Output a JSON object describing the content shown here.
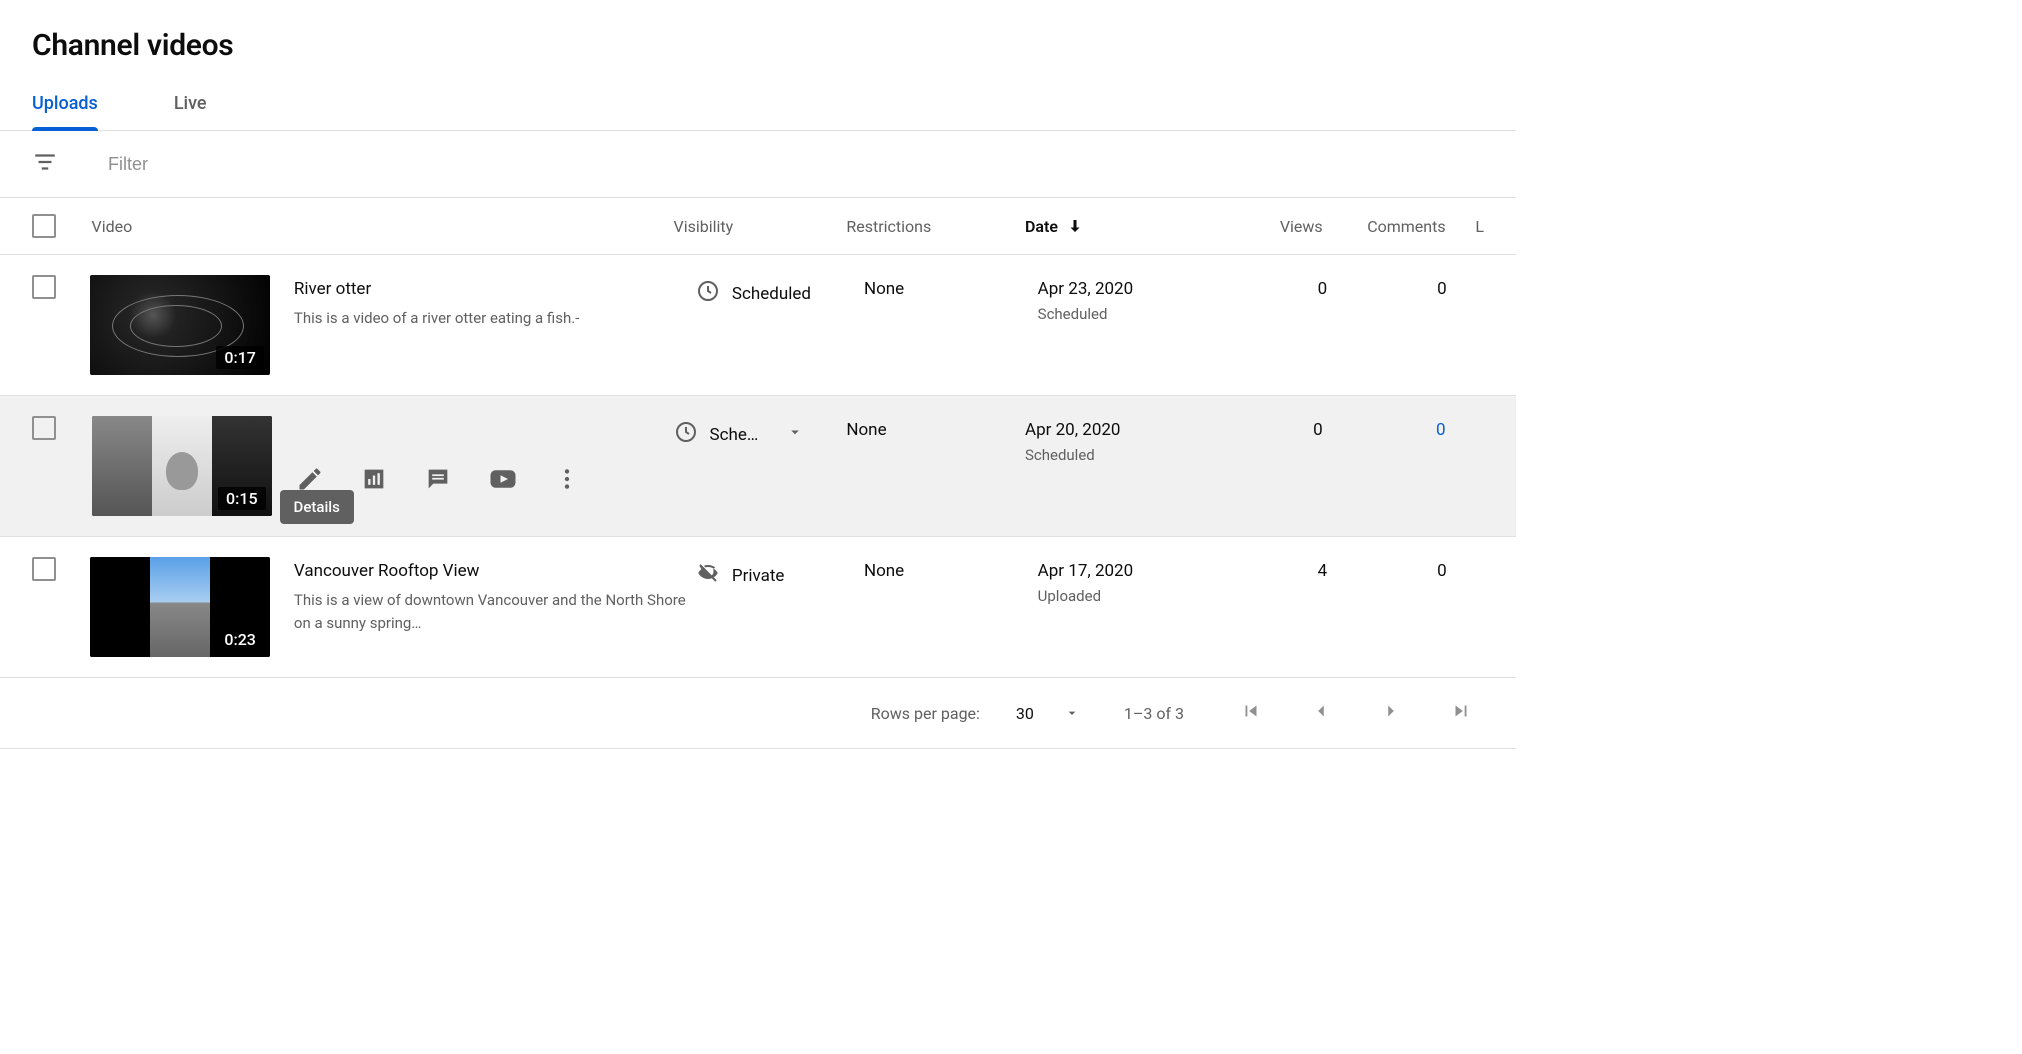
{
  "page_title": "Channel videos",
  "tabs": {
    "uploads": "Uploads",
    "live": "Live",
    "active": "uploads"
  },
  "filter": {
    "placeholder": "Filter"
  },
  "columns": {
    "video": "Video",
    "visibility": "Visibility",
    "restrictions": "Restrictions",
    "date": "Date",
    "views": "Views",
    "comments": "Comments",
    "rest": "L"
  },
  "sort": {
    "column": "date",
    "direction": "desc"
  },
  "row_tooltip": "Details",
  "rows": [
    {
      "title": "River otter",
      "description": "This is a video of a river otter eating a fish.-",
      "duration": "0:17",
      "visibility": {
        "icon": "clock",
        "label": "Scheduled",
        "editable": false
      },
      "restrictions": "None",
      "date": "Apr 23, 2020",
      "date_sub": "Scheduled",
      "views": "0",
      "comments": "0",
      "hovered": false
    },
    {
      "title": "",
      "description": "",
      "duration": "0:15",
      "visibility": {
        "icon": "clock",
        "label": "Sche…",
        "editable": true
      },
      "restrictions": "None",
      "date": "Apr 20, 2020",
      "date_sub": "Scheduled",
      "views": "0",
      "comments": "0",
      "comments_link": true,
      "hovered": true
    },
    {
      "title": "Vancouver Rooftop View",
      "description": "This is a view of downtown Vancouver and the North Shore on a sunny spring…",
      "duration": "0:23",
      "visibility": {
        "icon": "eye-off",
        "label": "Private",
        "editable": false
      },
      "restrictions": "None",
      "date": "Apr 17, 2020",
      "date_sub": "Uploaded",
      "views": "4",
      "comments": "0",
      "hovered": false
    }
  ],
  "pager": {
    "label": "Rows per page:",
    "page_size": "30",
    "range": "1–3 of 3"
  }
}
